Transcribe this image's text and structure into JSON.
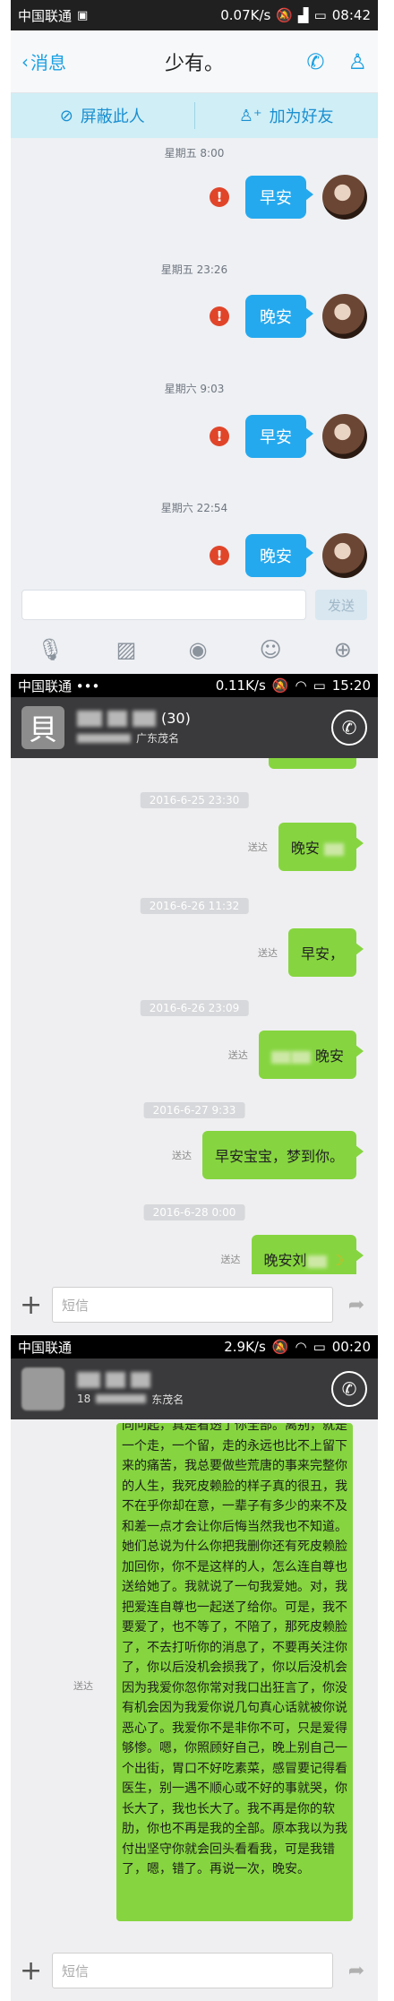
{
  "qq": {
    "status": {
      "carrier": "中国联通",
      "speed": "0.07K/s",
      "time": "08:42"
    },
    "header": {
      "back_label": "消息",
      "title": "少有。"
    },
    "actions": {
      "block": "屏蔽此人",
      "add_friend": "加为好友"
    },
    "messages": [
      {
        "time": "星期五 8:00",
        "text": "早安"
      },
      {
        "time": "星期五 23:26",
        "text": "晚安"
      },
      {
        "time": "星期六 9:03",
        "text": "早安"
      },
      {
        "time": "星期六 22:54",
        "text": "晚安"
      }
    ],
    "send_label": "发送",
    "icons": [
      "mic-icon",
      "image-icon",
      "camera-icon",
      "emoji-icon",
      "plus-icon"
    ]
  },
  "sms1": {
    "status": {
      "carrier": "中国联通 •••",
      "speed": "0.11K/s",
      "time": "15:20"
    },
    "contact": {
      "avatar_letter": "貝",
      "name_suffix": "(30)",
      "location": "广东茂名"
    },
    "messages": [
      {
        "date": "2016-6-25 23:30",
        "status": "送达",
        "text": "晚安"
      },
      {
        "date": "2016-6-26 11:32",
        "status": "送达",
        "text": "早安，"
      },
      {
        "date": "2016-6-26 23:09",
        "status": "送达",
        "text": "晚安"
      },
      {
        "date": "2016-6-27 9:33",
        "status": "送达",
        "text": "早安宝宝，梦到你。"
      },
      {
        "date": "2016-6-28 0:00",
        "status": "送达",
        "text": "晚安刘"
      }
    ],
    "input_placeholder": "短信"
  },
  "sms2": {
    "status": {
      "carrier": "中国联通",
      "speed": "2.9K/s",
      "time": "00:20"
    },
    "contact": {
      "number_prefix": "18",
      "location": "东茂名"
    },
    "long_message": {
      "status": "送达",
      "text": "同问起，真是看透了你全部。离别，就是一个走，一个留，走的永远也比不上留下来的痛苦，我总要做些荒唐的事来完整你的人生，我死皮赖脸的样子真的很丑，我不在乎你却在意，一辈子有多少的来不及和差一点才会让你后悔当然我也不知道。她们总说为什么你把我删你还有死皮赖脸加回你，你不是这样的人，怎么连自尊也送给她了。我就说了一句我爱她。对，我把爱连自尊也一起送了给你。可是，我不要爱了，也不等了，不陪了，那死皮赖脸了，不去打听你的消息了，不要再关注你了，你以后没机会损我了，你以后没机会因为我爱你忽你常对我口出狂言了，你没有机会因为我爱你说几句真心话就被你说恶心了。我爱你不是非你不可，只是爱得够惨。嗯，你照顾好自己，晚上别自己一个出街，胃口不好吃素菜，感冒要记得看医生，别一遇不顺心或不好的事就哭，你长大了，我也长大了。我不再是你的软肋，你也不再是我的全部。原本我以为我付出坚守你就会回头看看我，可是我错了，嗯，错了。再说一次，晚安。"
    },
    "input_placeholder": "短信"
  }
}
